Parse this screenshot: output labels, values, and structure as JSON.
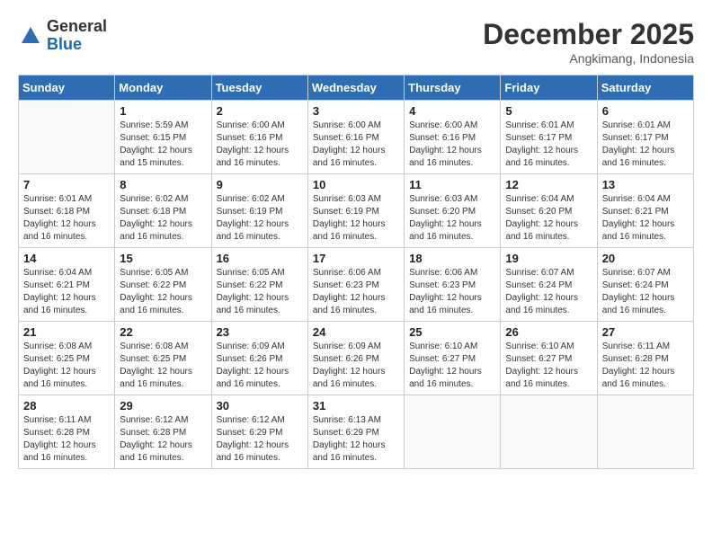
{
  "header": {
    "logo_general": "General",
    "logo_blue": "Blue",
    "month_title": "December 2025",
    "location": "Angkimang, Indonesia"
  },
  "days_of_week": [
    "Sunday",
    "Monday",
    "Tuesday",
    "Wednesday",
    "Thursday",
    "Friday",
    "Saturday"
  ],
  "weeks": [
    [
      {
        "day": "",
        "info": ""
      },
      {
        "day": "1",
        "info": "Sunrise: 5:59 AM\nSunset: 6:15 PM\nDaylight: 12 hours\nand 15 minutes."
      },
      {
        "day": "2",
        "info": "Sunrise: 6:00 AM\nSunset: 6:16 PM\nDaylight: 12 hours\nand 16 minutes."
      },
      {
        "day": "3",
        "info": "Sunrise: 6:00 AM\nSunset: 6:16 PM\nDaylight: 12 hours\nand 16 minutes."
      },
      {
        "day": "4",
        "info": "Sunrise: 6:00 AM\nSunset: 6:16 PM\nDaylight: 12 hours\nand 16 minutes."
      },
      {
        "day": "5",
        "info": "Sunrise: 6:01 AM\nSunset: 6:17 PM\nDaylight: 12 hours\nand 16 minutes."
      },
      {
        "day": "6",
        "info": "Sunrise: 6:01 AM\nSunset: 6:17 PM\nDaylight: 12 hours\nand 16 minutes."
      }
    ],
    [
      {
        "day": "7",
        "info": ""
      },
      {
        "day": "8",
        "info": "Sunrise: 6:02 AM\nSunset: 6:18 PM\nDaylight: 12 hours\nand 16 minutes."
      },
      {
        "day": "9",
        "info": "Sunrise: 6:02 AM\nSunset: 6:19 PM\nDaylight: 12 hours\nand 16 minutes."
      },
      {
        "day": "10",
        "info": "Sunrise: 6:03 AM\nSunset: 6:19 PM\nDaylight: 12 hours\nand 16 minutes."
      },
      {
        "day": "11",
        "info": "Sunrise: 6:03 AM\nSunset: 6:20 PM\nDaylight: 12 hours\nand 16 minutes."
      },
      {
        "day": "12",
        "info": "Sunrise: 6:04 AM\nSunset: 6:20 PM\nDaylight: 12 hours\nand 16 minutes."
      },
      {
        "day": "13",
        "info": "Sunrise: 6:04 AM\nSunset: 6:21 PM\nDaylight: 12 hours\nand 16 minutes."
      }
    ],
    [
      {
        "day": "14",
        "info": ""
      },
      {
        "day": "15",
        "info": "Sunrise: 6:05 AM\nSunset: 6:22 PM\nDaylight: 12 hours\nand 16 minutes."
      },
      {
        "day": "16",
        "info": "Sunrise: 6:05 AM\nSunset: 6:22 PM\nDaylight: 12 hours\nand 16 minutes."
      },
      {
        "day": "17",
        "info": "Sunrise: 6:06 AM\nSunset: 6:23 PM\nDaylight: 12 hours\nand 16 minutes."
      },
      {
        "day": "18",
        "info": "Sunrise: 6:06 AM\nSunset: 6:23 PM\nDaylight: 12 hours\nand 16 minutes."
      },
      {
        "day": "19",
        "info": "Sunrise: 6:07 AM\nSunset: 6:24 PM\nDaylight: 12 hours\nand 16 minutes."
      },
      {
        "day": "20",
        "info": "Sunrise: 6:07 AM\nSunset: 6:24 PM\nDaylight: 12 hours\nand 16 minutes."
      }
    ],
    [
      {
        "day": "21",
        "info": ""
      },
      {
        "day": "22",
        "info": "Sunrise: 6:08 AM\nSunset: 6:25 PM\nDaylight: 12 hours\nand 16 minutes."
      },
      {
        "day": "23",
        "info": "Sunrise: 6:09 AM\nSunset: 6:26 PM\nDaylight: 12 hours\nand 16 minutes."
      },
      {
        "day": "24",
        "info": "Sunrise: 6:09 AM\nSunset: 6:26 PM\nDaylight: 12 hours\nand 16 minutes."
      },
      {
        "day": "25",
        "info": "Sunrise: 6:10 AM\nSunset: 6:27 PM\nDaylight: 12 hours\nand 16 minutes."
      },
      {
        "day": "26",
        "info": "Sunrise: 6:10 AM\nSunset: 6:27 PM\nDaylight: 12 hours\nand 16 minutes."
      },
      {
        "day": "27",
        "info": "Sunrise: 6:11 AM\nSunset: 6:28 PM\nDaylight: 12 hours\nand 16 minutes."
      }
    ],
    [
      {
        "day": "28",
        "info": "Sunrise: 6:11 AM\nSunset: 6:28 PM\nDaylight: 12 hours\nand 16 minutes."
      },
      {
        "day": "29",
        "info": "Sunrise: 6:12 AM\nSunset: 6:28 PM\nDaylight: 12 hours\nand 16 minutes."
      },
      {
        "day": "30",
        "info": "Sunrise: 6:12 AM\nSunset: 6:29 PM\nDaylight: 12 hours\nand 16 minutes."
      },
      {
        "day": "31",
        "info": "Sunrise: 6:13 AM\nSunset: 6:29 PM\nDaylight: 12 hours\nand 16 minutes."
      },
      {
        "day": "",
        "info": ""
      },
      {
        "day": "",
        "info": ""
      },
      {
        "day": "",
        "info": ""
      }
    ]
  ],
  "week7_info": {
    "7": "Sunrise: 6:01 AM\nSunset: 6:18 PM\nDaylight: 12 hours\nand 16 minutes.",
    "14": "Sunrise: 6:04 AM\nSunset: 6:21 PM\nDaylight: 12 hours\nand 16 minutes.",
    "21": "Sunrise: 6:08 AM\nSunset: 6:25 PM\nDaylight: 12 hours\nand 16 minutes."
  }
}
